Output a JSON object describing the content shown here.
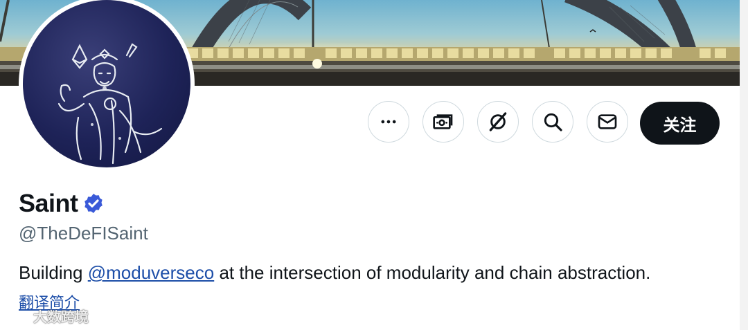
{
  "profile": {
    "display_name": "Saint",
    "handle": "@TheDeFISaint",
    "verified": true,
    "bio_prefix": "Building ",
    "bio_mention": "@moduverseco",
    "bio_suffix": " at the intersection of modularity and chain abstraction.",
    "translate_label": "翻译简介"
  },
  "actions": {
    "more_icon": "more-horizontal-icon",
    "subscribe_icon": "money-icon",
    "grok_icon": "grok-icon",
    "search_icon": "search-icon",
    "message_icon": "envelope-icon",
    "follow_label": "关注"
  },
  "watermark": {
    "text": "大数跨境"
  },
  "colors": {
    "text_primary": "#0f1419",
    "text_secondary": "#536471",
    "link": "#1d4ea8",
    "verified": "#3a5ad8",
    "follow_bg": "#0f1419",
    "border": "#cfd9de"
  }
}
